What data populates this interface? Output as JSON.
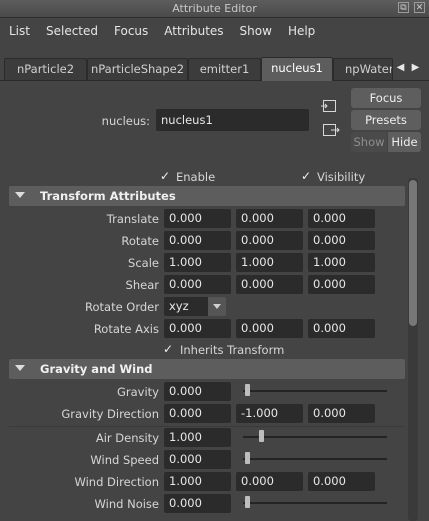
{
  "window": {
    "title": "Attribute Editor"
  },
  "menu": [
    "List",
    "Selected",
    "Focus",
    "Attributes",
    "Show",
    "Help"
  ],
  "tabs": [
    "nParticle2",
    "nParticleShape2",
    "emitter1",
    "nucleus1",
    "npWater"
  ],
  "active_tab": "nucleus1",
  "node": {
    "label": "nucleus:",
    "value": "nucleus1"
  },
  "buttons": {
    "focus": "Focus",
    "presets": "Presets",
    "show": "Show",
    "hide": "Hide"
  },
  "checks": {
    "enable": "Enable",
    "visibility": "Visibility",
    "inherits": "Inherits Transform"
  },
  "transform": {
    "title": "Transform Attributes",
    "translate": {
      "label": "Translate",
      "v": [
        "0.000",
        "0.000",
        "0.000"
      ]
    },
    "rotate": {
      "label": "Rotate",
      "v": [
        "0.000",
        "0.000",
        "0.000"
      ]
    },
    "scale": {
      "label": "Scale",
      "v": [
        "1.000",
        "1.000",
        "1.000"
      ]
    },
    "shear": {
      "label": "Shear",
      "v": [
        "0.000",
        "0.000",
        "0.000"
      ]
    },
    "rotate_order": {
      "label": "Rotate Order",
      "value": "xyz"
    },
    "rotate_axis": {
      "label": "Rotate Axis",
      "v": [
        "0.000",
        "0.000",
        "0.000"
      ]
    }
  },
  "gravity": {
    "title": "Gravity and Wind",
    "gravity": {
      "label": "Gravity",
      "value": "0.000"
    },
    "gravity_direction": {
      "label": "Gravity Direction",
      "v": [
        "0.000",
        "-1.000",
        "0.000"
      ]
    },
    "air_density": {
      "label": "Air Density",
      "value": "1.000"
    },
    "wind_speed": {
      "label": "Wind Speed",
      "value": "0.000"
    },
    "wind_direction": {
      "label": "Wind Direction",
      "v": [
        "1.000",
        "0.000",
        "0.000"
      ]
    },
    "wind_noise": {
      "label": "Wind Noise",
      "value": "0.000"
    }
  },
  "sliders": {
    "gravity": 0.0,
    "air_density": 0.1,
    "wind_speed": 0.0,
    "wind_noise": 0.0
  }
}
